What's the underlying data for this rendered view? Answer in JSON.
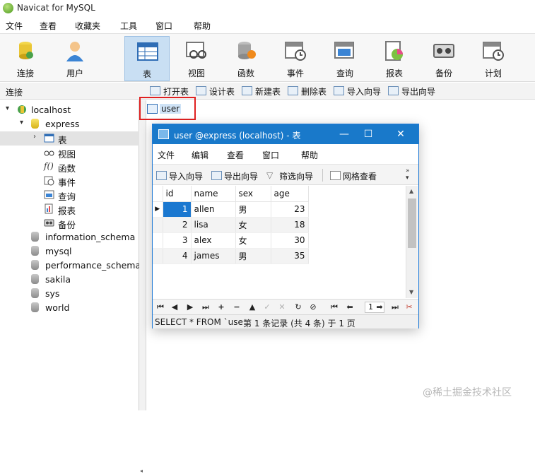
{
  "app": {
    "title": "Navicat for MySQL"
  },
  "menubar": [
    "文件",
    "查看",
    "收藏夹",
    "工具",
    "窗口",
    "帮助"
  ],
  "toolbar": [
    {
      "label": "连接",
      "icon": "connection-icon"
    },
    {
      "label": "用户",
      "icon": "user-icon"
    },
    {
      "label": "表",
      "icon": "table-icon",
      "active": true
    },
    {
      "label": "视图",
      "icon": "view-icon"
    },
    {
      "label": "函数",
      "icon": "function-icon"
    },
    {
      "label": "事件",
      "icon": "event-icon"
    },
    {
      "label": "查询",
      "icon": "query-icon"
    },
    {
      "label": "报表",
      "icon": "report-icon"
    },
    {
      "label": "备份",
      "icon": "backup-icon"
    },
    {
      "label": "计划",
      "icon": "schedule-icon"
    }
  ],
  "object_toolbar": {
    "connection_label": "连接",
    "buttons": [
      "打开表",
      "设计表",
      "新建表",
      "删除表",
      "导入向导",
      "导出向导"
    ]
  },
  "tree": {
    "connection": "localhost",
    "database": "express",
    "children": [
      "表",
      "视图",
      "函数",
      "事件",
      "查询",
      "报表",
      "备份"
    ],
    "other_databases": [
      "information_schema",
      "mysql",
      "performance_schema",
      "sakila",
      "sys",
      "world"
    ]
  },
  "objects": {
    "selected_table": "user"
  },
  "table_window": {
    "title": "user @express (localhost) - 表",
    "menu": [
      "文件",
      "编辑",
      "查看",
      "窗口",
      "帮助"
    ],
    "tools": [
      "导入向导",
      "导出向导",
      "筛选向导",
      "网格查看"
    ],
    "columns": [
      "id",
      "name",
      "sex",
      "age"
    ],
    "rows": [
      [
        "1",
        "allen",
        "男",
        "23"
      ],
      [
        "2",
        "lisa",
        "女",
        "18"
      ],
      [
        "3",
        "alex",
        "女",
        "30"
      ],
      [
        "4",
        "james",
        "男",
        "35"
      ]
    ],
    "page_number": "1",
    "status_sql": "SELECT * FROM `use",
    "status_record": "第 1 条记录 (共 4 条) 于 1 页"
  },
  "watermark": "@稀土掘金技术社区",
  "colors": {
    "accent": "#1979ca",
    "selection": "#1b78d0",
    "highlight_box": "#e02020"
  }
}
